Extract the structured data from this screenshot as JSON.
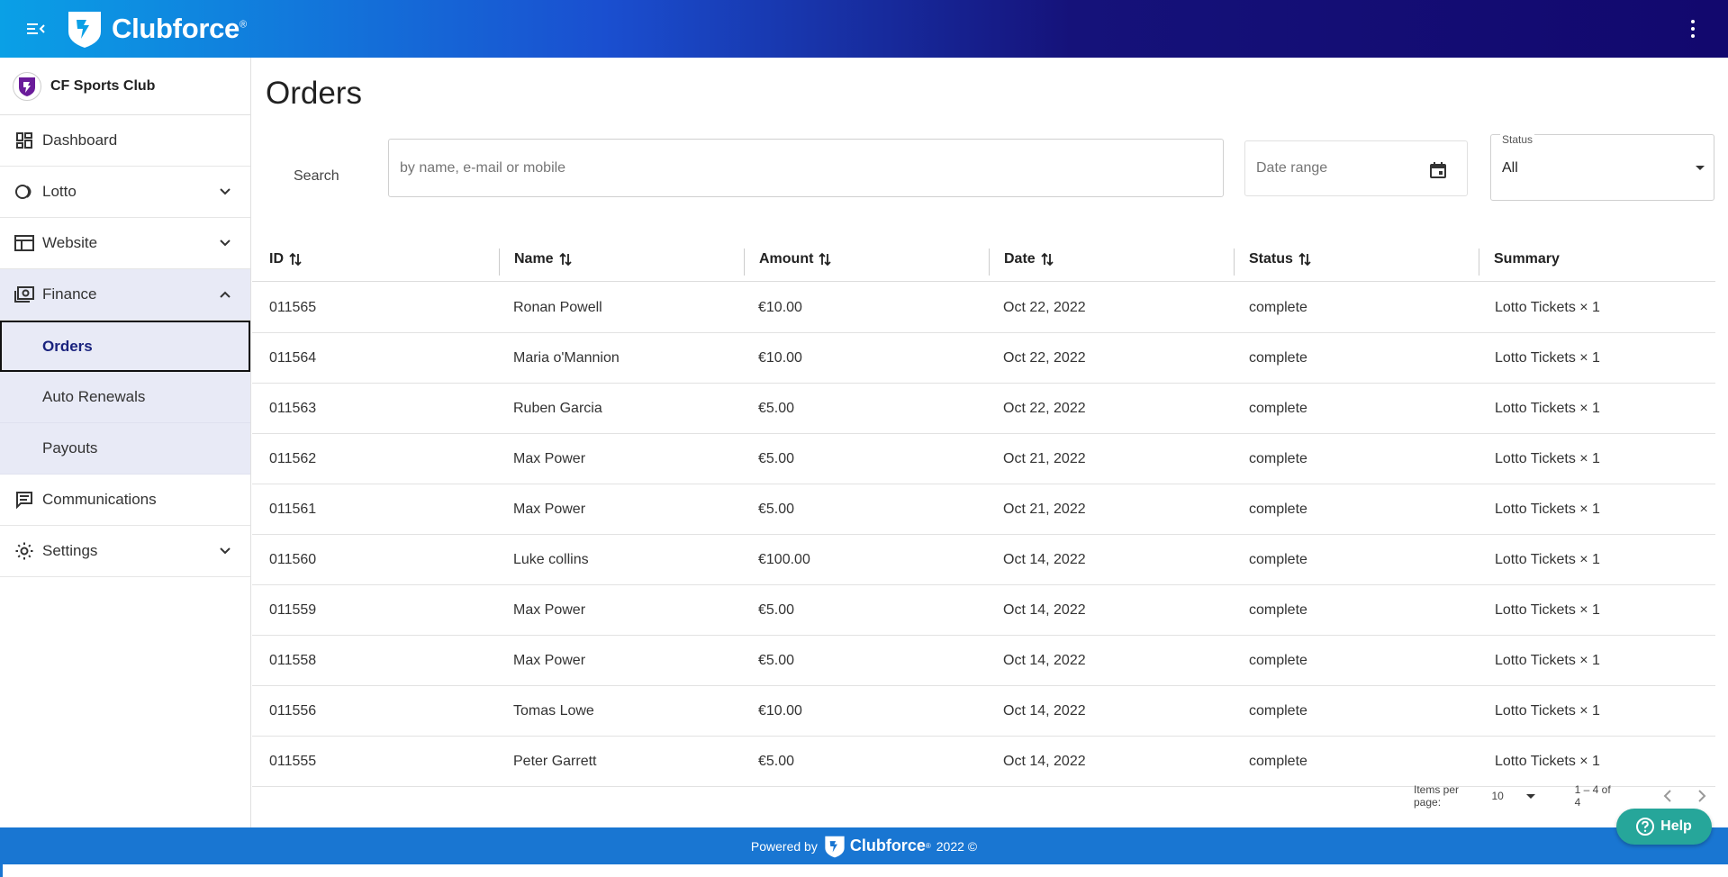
{
  "app": {
    "brand": "Clubforce",
    "brand_mark": "®"
  },
  "sidebar": {
    "club_name": "CF Sports Club",
    "items": [
      {
        "label": "Dashboard",
        "icon": "dashboard-icon"
      },
      {
        "label": "Lotto",
        "icon": "lotto-icon",
        "expandable": true
      },
      {
        "label": "Website",
        "icon": "website-icon",
        "expandable": true
      },
      {
        "label": "Finance",
        "icon": "finance-icon",
        "expandable": true,
        "expanded": true,
        "children": [
          {
            "label": "Orders",
            "active": true
          },
          {
            "label": "Auto Renewals"
          },
          {
            "label": "Payouts"
          }
        ]
      },
      {
        "label": "Communications",
        "icon": "communications-icon"
      },
      {
        "label": "Settings",
        "icon": "settings-icon",
        "expandable": true
      }
    ]
  },
  "main": {
    "title": "Orders",
    "search_label": "Search",
    "search_placeholder": "by name, e-mail or mobile",
    "date_placeholder": "Date range",
    "status_caption": "Status",
    "status_value": "All"
  },
  "table": {
    "columns": [
      "ID",
      "Name",
      "Amount",
      "Date",
      "Status",
      "Summary"
    ],
    "rows": [
      {
        "id": "011565",
        "name": "Ronan Powell",
        "amount": "€10.00",
        "date": "Oct 22, 2022",
        "status": "complete",
        "summary": "Lotto Tickets × 1"
      },
      {
        "id": "011564",
        "name": "Maria o'Mannion",
        "amount": "€10.00",
        "date": "Oct 22, 2022",
        "status": "complete",
        "summary": "Lotto Tickets × 1"
      },
      {
        "id": "011563",
        "name": "Ruben Garcia",
        "amount": "€5.00",
        "date": "Oct 22, 2022",
        "status": "complete",
        "summary": "Lotto Tickets × 1"
      },
      {
        "id": "011562",
        "name": "Max Power",
        "amount": "€5.00",
        "date": "Oct 21, 2022",
        "status": "complete",
        "summary": "Lotto Tickets × 1"
      },
      {
        "id": "011561",
        "name": "Max Power",
        "amount": "€5.00",
        "date": "Oct 21, 2022",
        "status": "complete",
        "summary": "Lotto Tickets × 1"
      },
      {
        "id": "011560",
        "name": "Luke collins",
        "amount": "€100.00",
        "date": "Oct 14, 2022",
        "status": "complete",
        "summary": "Lotto Tickets × 1"
      },
      {
        "id": "011559",
        "name": "Max Power",
        "amount": "€5.00",
        "date": "Oct 14, 2022",
        "status": "complete",
        "summary": "Lotto Tickets × 1"
      },
      {
        "id": "011558",
        "name": "Max Power",
        "amount": "€5.00",
        "date": "Oct 14, 2022",
        "status": "complete",
        "summary": "Lotto Tickets × 1"
      },
      {
        "id": "011556",
        "name": "Tomas Lowe",
        "amount": "€10.00",
        "date": "Oct 14, 2022",
        "status": "complete",
        "summary": "Lotto Tickets × 1"
      },
      {
        "id": "011555",
        "name": "Peter Garrett",
        "amount": "€5.00",
        "date": "Oct 14, 2022",
        "status": "complete",
        "summary": "Lotto Tickets × 1"
      }
    ]
  },
  "paginator": {
    "items_per_page_label": "Items per page:",
    "items_per_page": "10",
    "range": "1 – 4 of 4"
  },
  "footer": {
    "powered_by": "Powered by",
    "brand": "Clubforce",
    "brand_mark": "®",
    "year": "2022 ©"
  },
  "help": {
    "label": "Help"
  },
  "colors": {
    "topbar_start": "#0aa0e6",
    "topbar_end": "#12086e",
    "footer": "#1976d2",
    "active_nav_bg": "#e8eaf6",
    "help_button": "#26a69a"
  }
}
